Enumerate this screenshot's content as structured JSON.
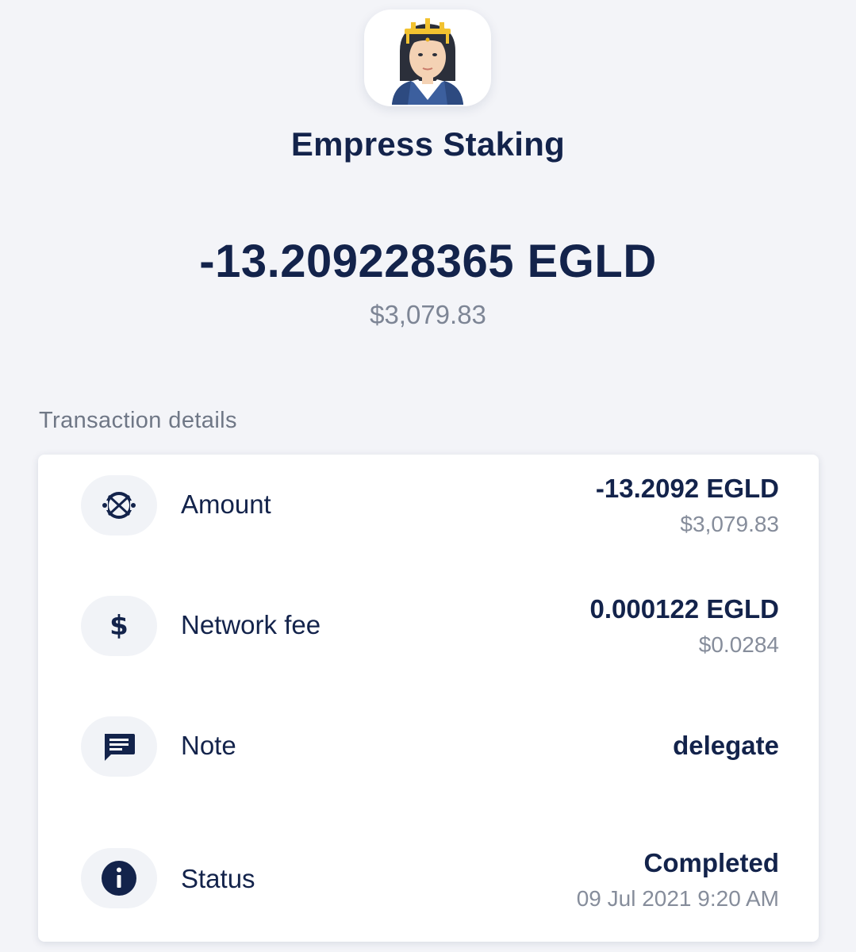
{
  "header": {
    "provider_name": "Empress Staking",
    "avatar_icon": "empress-avatar-icon"
  },
  "summary": {
    "amount": "-13.209228365 EGLD",
    "amount_fiat": "$3,079.83"
  },
  "details": {
    "section_title": "Transaction details",
    "rows": [
      {
        "icon": "egld-logo-icon",
        "label": "Amount",
        "value": "-13.2092 EGLD",
        "sub": "$3,079.83"
      },
      {
        "icon": "dollar-icon",
        "label": "Network fee",
        "value": "0.000122 EGLD",
        "sub": "$0.0284"
      },
      {
        "icon": "message-icon",
        "label": "Note",
        "value": "delegate",
        "sub": ""
      },
      {
        "icon": "info-icon",
        "label": "Status",
        "value": "Completed",
        "sub": "09 Jul 2021 9:20 AM"
      }
    ]
  },
  "colors": {
    "primary_text": "#13234b",
    "secondary_text": "#7d8595",
    "background": "#f3f4f8",
    "card": "#ffffff"
  }
}
